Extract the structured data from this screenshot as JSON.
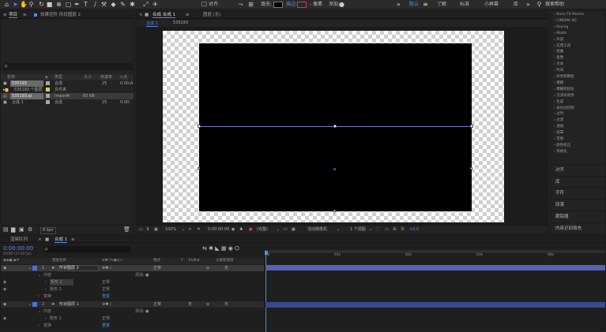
{
  "toolbar": {
    "align_label": "对齐",
    "fill_label": "填充:",
    "stroke_label": "描边:",
    "stroke_width": "- 像素",
    "add_label": "添加:",
    "workspaces": [
      "默认",
      "了解",
      "标准",
      "小屏幕",
      "库"
    ],
    "search_placeholder": "搜索帮助"
  },
  "project": {
    "tabs": [
      "项目",
      "效果控件 形状图层 2"
    ],
    "search_placeholder": "ρ.",
    "columns": [
      "名称",
      "类型",
      "大小",
      "帧速率",
      "入点"
    ],
    "rows": [
      {
        "name": "535193",
        "type": "合成",
        "size": "",
        "fps": "25",
        "in": "0:00:",
        "color": "#a6a6a6",
        "selected": true
      },
      {
        "name": "535193 个图层",
        "type": "文件夹",
        "size": "",
        "fps": "",
        "in": "",
        "color": "#e0c85a",
        "selected": false
      },
      {
        "name": "535193.ai",
        "type": "ImporAI",
        "size": "65 KB",
        "fps": "",
        "in": "",
        "color": "#a6a6a6",
        "selected": true
      },
      {
        "name": "合成 1",
        "type": "合成",
        "size": "",
        "fps": "25",
        "in": "0:00:",
        "color": "#a6a6a6",
        "selected": false
      }
    ],
    "bpc": "8 bpc"
  },
  "composition": {
    "tab_label": "合成 合成 1",
    "layer_tab": "图层 (无)",
    "breadcrumbs": [
      "合成 1",
      "535193"
    ],
    "zoom": "100%",
    "timecode": "0:00:00:00",
    "quality": "(完整)",
    "renderer": "活动摄像机",
    "views": "1 个视图",
    "exposure": "+0.0"
  },
  "effects": {
    "items": [
      "Boris FX Mocha",
      "CINEMA 4D",
      "Keying",
      "Matte",
      "声道",
      "实用工具",
      "扭曲",
      "抠像",
      "文本",
      "时间",
      "杂色和颗粒",
      "模糊",
      "模糊和锐化",
      "沉浸式视频",
      "生成",
      "表达式控制",
      "过时",
      "过渡",
      "透视",
      "遮罩",
      "音频",
      "颜色校正",
      "风格化"
    ],
    "panels": [
      "对齐",
      "库",
      "字符",
      "段落",
      "跟踪器",
      "内容识别填充"
    ]
  },
  "timeline": {
    "tabs": [
      "渲染队列",
      "合成 1"
    ],
    "timecode": "0:00:00:00",
    "fps_info": "00000 (25.00 fps)",
    "search_placeholder": "ρ.",
    "columns": [
      "图层名称",
      "模式",
      "T",
      "TrkMat",
      "父级和链接"
    ],
    "layers": [
      {
        "num": "1",
        "name": "形状图层 2",
        "mode": "正常",
        "trk": "",
        "parent": "无",
        "selected": true
      },
      {
        "num": "2",
        "name": "形状图层 1",
        "mode": "正常",
        "trk": "无",
        "parent": "无",
        "selected": false
      }
    ],
    "props": {
      "contents": "内容",
      "add": "添加:",
      "shape2": "矩形 2",
      "shape1": "矩形 1",
      "normal": "正常",
      "transform": "变换",
      "reset": "重置"
    },
    "ruler": [
      "0s",
      "01s",
      "02s",
      "03s",
      "04s"
    ]
  }
}
